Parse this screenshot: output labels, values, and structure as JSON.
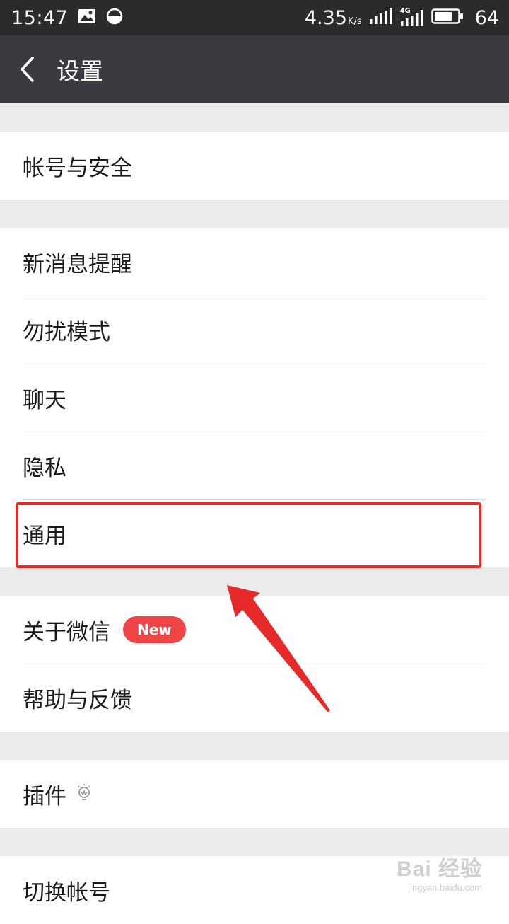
{
  "status_bar": {
    "time": "15:47",
    "speed": "4.35",
    "speed_unit": "K/s",
    "network": "4G",
    "battery": "64"
  },
  "header": {
    "title": "设置"
  },
  "groups": [
    {
      "items": [
        {
          "label": "帐号与安全"
        }
      ]
    },
    {
      "items": [
        {
          "label": "新消息提醒"
        },
        {
          "label": "勿扰模式"
        },
        {
          "label": "聊天"
        },
        {
          "label": "隐私"
        },
        {
          "label": "通用",
          "highlighted": true
        }
      ]
    },
    {
      "items": [
        {
          "label": "关于微信",
          "badge": "New"
        },
        {
          "label": "帮助与反馈"
        }
      ]
    },
    {
      "items": [
        {
          "label": "插件",
          "icon": "lightbulb-icon"
        }
      ]
    },
    {
      "items": [
        {
          "label": "切换帐号"
        }
      ]
    }
  ],
  "watermark": {
    "main": "Bai 经验",
    "sub": "jingyan.baidu.com"
  },
  "colors": {
    "status_bar_bg": "#2b2b2b",
    "title_bar_bg": "#393a3f",
    "page_bg": "#ebebeb",
    "badge": "#f04546",
    "annotation": "#e62a2a"
  }
}
